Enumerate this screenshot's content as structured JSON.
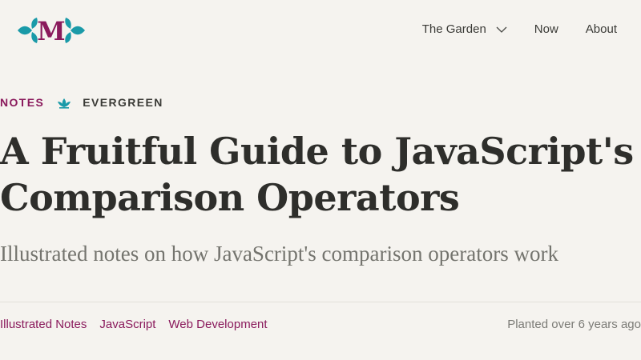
{
  "brand": {
    "logo_letter": "M",
    "accent_color": "#1a9aa8",
    "brand_color": "#8a1a5c"
  },
  "nav": {
    "items": [
      {
        "label": "The Garden",
        "has_dropdown": true
      },
      {
        "label": "Now"
      },
      {
        "label": "About"
      }
    ]
  },
  "post": {
    "category": "NOTES",
    "stage_icon": "sprout-icon",
    "stage": "EVERGREEN",
    "title": "A Fruitful Guide to JavaScript's Comparison Operators",
    "subtitle": "Illustrated notes on how JavaScript's comparison operators work",
    "tags": [
      "Illustrated Notes",
      "JavaScript",
      "Web Development"
    ],
    "planted": "Planted over 6 years ago"
  }
}
